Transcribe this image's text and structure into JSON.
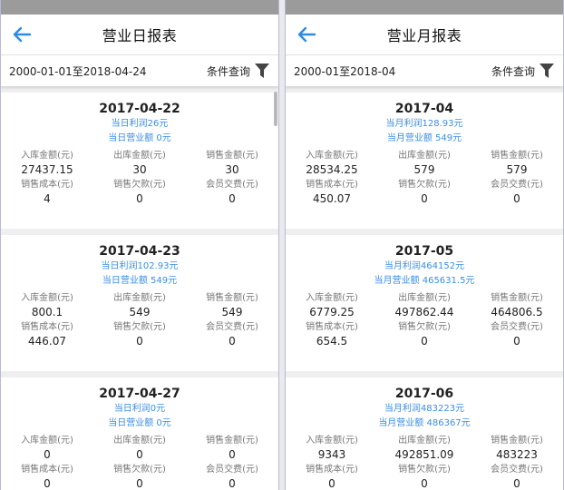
{
  "daily": {
    "title": "营业日报表",
    "range": "2000-01-01至2018-04-24",
    "query": "条件查询",
    "labels": {
      "in": "入库金额(元)",
      "out": "出库金额(元)",
      "sales": "销售金额(元)",
      "cost": "销售成本(元)",
      "debt": "销售欠款(元)",
      "member": "会员交费(元)"
    },
    "cards": [
      {
        "date": "2017-04-22",
        "profit": "当日利润26元",
        "revenue": "当日营业额 0元",
        "in": "27437.15",
        "out": "30",
        "sales": "30",
        "cost": "4",
        "debt": "0",
        "member": "0"
      },
      {
        "date": "2017-04-23",
        "profit": "当日利润102.93元",
        "revenue": "当日营业额 549元",
        "in": "800.1",
        "out": "549",
        "sales": "549",
        "cost": "446.07",
        "debt": "0",
        "member": "0"
      },
      {
        "date": "2017-04-27",
        "profit": "当日利润0元",
        "revenue": "当日营业额 0元",
        "in": "0",
        "out": "0",
        "sales": "0",
        "cost": "0",
        "debt": "0",
        "member": "0"
      }
    ]
  },
  "monthly": {
    "title": "营业月报表",
    "range": "2000-01至2018-04",
    "query": "条件查询",
    "labels": {
      "in": "入库金额(元)",
      "out": "出库金额(元)",
      "sales": "销售金额(元)",
      "cost": "销售成本(元)",
      "debt": "销售欠款(元)",
      "member": "会员交费(元)"
    },
    "cards": [
      {
        "date": "2017-04",
        "profit": "当月利润128.93元",
        "revenue": "当月营业额 549元",
        "in": "28534.25",
        "out": "579",
        "sales": "579",
        "cost": "450.07",
        "debt": "0",
        "member": "0"
      },
      {
        "date": "2017-05",
        "profit": "当月利润464152元",
        "revenue": "当月营业额 465631.5元",
        "in": "6779.25",
        "out": "497862.44",
        "sales": "464806.5",
        "cost": "654.5",
        "debt": "0",
        "member": "0"
      },
      {
        "date": "2017-06",
        "profit": "当月利润483223元",
        "revenue": "当月营业额 486367元",
        "in": "9343",
        "out": "492851.09",
        "sales": "483223",
        "cost": "0",
        "debt": "0",
        "member": "0"
      }
    ]
  },
  "colors": {
    "accent": "#3a8ee6",
    "status_bar": "#9b9b9b"
  },
  "icons": {
    "back": "arrow-left-icon",
    "filter": "funnel-icon"
  }
}
